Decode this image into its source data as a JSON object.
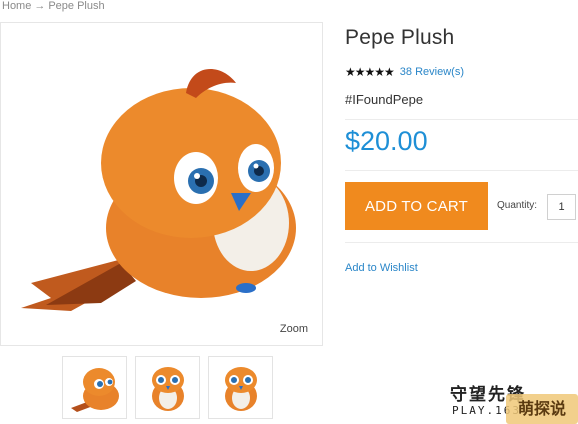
{
  "breadcrumb": {
    "home": "Home",
    "separator": "→",
    "current": "Pepe Plush"
  },
  "product": {
    "title": "Pepe Plush",
    "rating_stars": "★★★★★",
    "rating_value": 5,
    "reviews_link": "38 Review(s)",
    "hashtag": "#IFoundPepe",
    "price": "$20.00",
    "add_to_cart": "ADD TO CART",
    "quantity_label": "Quantity:",
    "quantity_value": "1",
    "wishlist_link": "Add to Wishlist"
  },
  "gallery": {
    "zoom_label": "Zoom",
    "thumbnails": [
      "side-view",
      "front-view",
      "front-view-alt"
    ]
  },
  "watermark": {
    "chinese_text": "守望先锋",
    "site_text": "PLAY.163",
    "badge_text": "萌探说"
  },
  "colors": {
    "accent_orange": "#f08a1e",
    "price_blue": "#1e8fd6",
    "link_blue": "#2a86c8"
  },
  "icons": {
    "rating": "star-icon",
    "plush": "plush-bird-image"
  }
}
